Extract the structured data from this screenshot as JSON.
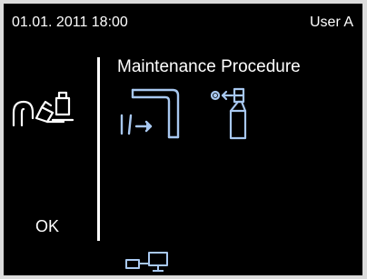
{
  "status_bar": {
    "datetime": "01.01. 2011 18:00",
    "user": "User A"
  },
  "panel": {
    "title": "Maintenance Procedure",
    "ok_label": "OK"
  },
  "icons": {
    "left": "handpiece-maintenance-icon",
    "water": "water-pipe-flow-icon",
    "spray": "spray-can-icon",
    "network": "network-connection-icon"
  },
  "colors": {
    "background": "#000000",
    "text": "#ffffff",
    "icon_accent": "#a8c8f0",
    "frame": "#dcdcdc"
  }
}
